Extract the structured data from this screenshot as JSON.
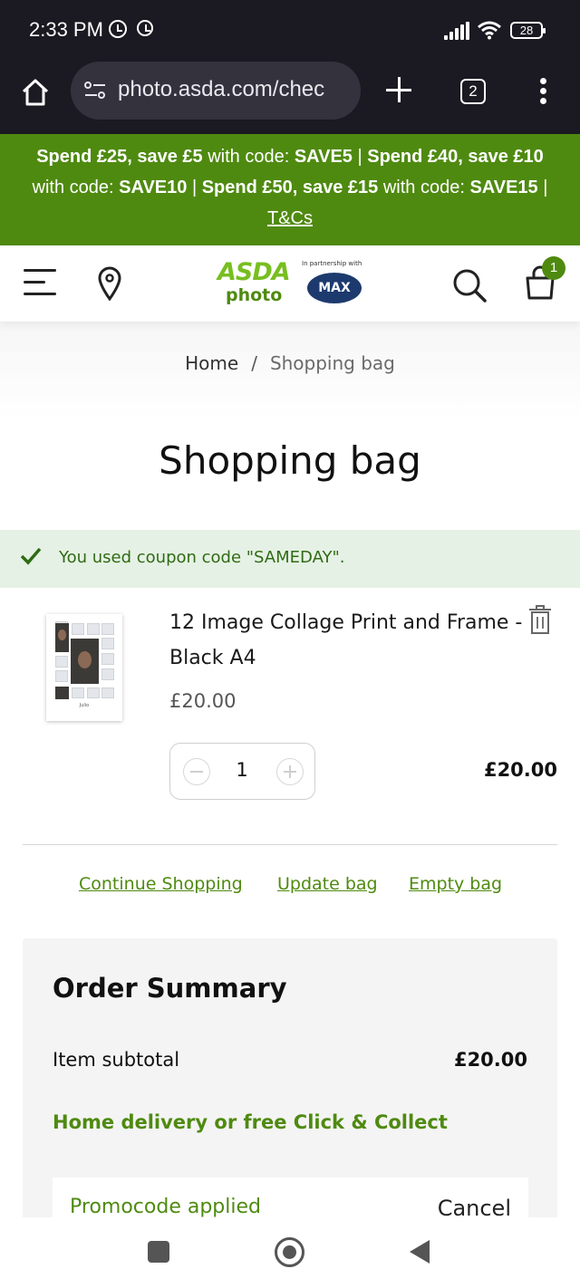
{
  "status_bar": {
    "time": "2:33 PM",
    "battery": "28",
    "icons": [
      "alarm-icon",
      "clock-icon",
      "signal-icon",
      "wifi-icon",
      "battery-icon"
    ]
  },
  "browser": {
    "url": "photo.asda.com/chec",
    "tab_count": "2",
    "icons": [
      "home-icon",
      "site-settings-icon",
      "new-tab-icon",
      "tabs-icon",
      "more-menu-icon"
    ]
  },
  "promo_banner": {
    "part1_bold": "Spend £25, save £5",
    "part1_text": " with code: ",
    "code1": "SAVE5",
    "sep": " | ",
    "part2_bold": "Spend £40, save £10",
    "part2_text": " with code: ",
    "code2": "SAVE10",
    "part3_bold": "Spend £50, save £15",
    "part3_text": " with code: ",
    "code3": "SAVE15",
    "sep_end": " |",
    "tc_label": "T&Cs"
  },
  "header": {
    "logo_top": "ASDA",
    "logo_bottom": "photo",
    "partner_text": "In partnership with",
    "partner_logo": "MAX",
    "bag_count": "1",
    "icons": [
      "menu-icon",
      "location-pin-icon",
      "search-icon",
      "shopping-bag-icon"
    ]
  },
  "breadcrumb": {
    "home": "Home",
    "separator": "/",
    "current": "Shopping bag"
  },
  "page_title": "Shopping bag",
  "notice": {
    "text": "You used coupon code \"SAMEDAY\"."
  },
  "cart_item": {
    "name": "12 Image Collage Print and Frame - Black A4",
    "price": "£20.00",
    "quantity": "1",
    "line_total": "£20.00",
    "thumb_caption": "Julio"
  },
  "actions": {
    "continue": "Continue Shopping",
    "update": "Update bag",
    "empty": "Empty bag"
  },
  "summary": {
    "title": "Order Summary",
    "subtotal_label": "Item subtotal",
    "subtotal_value": "£20.00",
    "delivery": "Home delivery or free Click & Collect",
    "promo_applied": "Promocode applied",
    "cancel": "Cancel"
  },
  "colors": {
    "brand_green": "#4f8a10",
    "asda_green": "#78be20",
    "notice_bg": "#e6f1e5",
    "chrome_dark": "#1b1a22"
  }
}
